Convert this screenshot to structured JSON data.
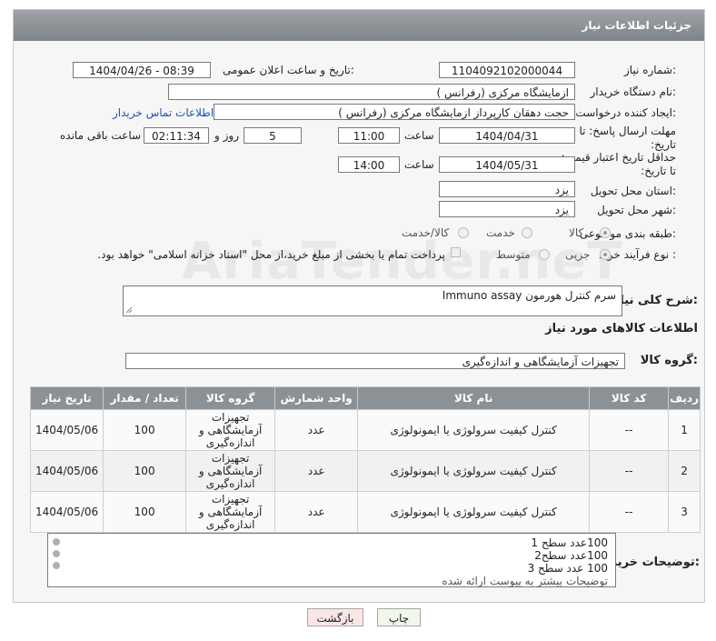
{
  "header": {
    "title": "جزئیات اطلاعات نیاز"
  },
  "watermark": "AriaTender.neT",
  "form": {
    "need_number_label": "شماره نیاز:",
    "need_number": "1104092102000044",
    "announce_label": "تاریخ و ساعت اعلان عمومی:",
    "announce_value": "1404/04/26 - 08:39",
    "buyer_org_label": "نام دستگاه خریدار:",
    "buyer_org": "ازمایشگاه مرکزی (رفرانس )",
    "creator_label": "ایجاد کننده درخواست:",
    "creator": "حجت دهقان کارپرداز ازمایشگاه مرکزی (رفرانس )",
    "contact_link": "اطلاعات تماس خریدار",
    "reply_deadline_label": "مهلت ارسال پاسخ: تا تاریخ:",
    "reply_date": "1404/04/31",
    "time_label": "ساعت",
    "reply_time": "11:00",
    "days_value": "5",
    "days_label": "روز و",
    "remaining_value": "02:11:34",
    "remaining_label": "ساعت باقی مانده",
    "price_deadline_label": "حداقل تاریخ اعتبار قیمت: تا تاریخ:",
    "price_date": "1404/05/31",
    "price_time_label": "ساعت",
    "price_time": "14:00",
    "province_label": "استان محل تحویل:",
    "province": "یزد",
    "city_label": "شهر محل تحویل:",
    "city": "یزد",
    "category_label": "طبقه بندی موضوعی:",
    "category_options": [
      "کالا",
      "خدمت",
      "کالا/خدمت"
    ],
    "process_label": "نوع فرآیند خرید :",
    "process_options": [
      "جزیی",
      "متوسط"
    ],
    "payment_note": "پرداخت تمام یا بخشی از مبلغ خرید،از محل \"اسناد خزانه اسلامی\" خواهد بود.",
    "desc_label": "شرح کلی نیاز:",
    "description": "سرم کنترل هورمون Immuno assay",
    "goods_section_title": "اطلاعات کالاهای مورد نیاز",
    "goods_group_label": "گروه کالا:",
    "goods_group": "تجهیزات آزمایشگاهی و اندازه‌گیری"
  },
  "table": {
    "headers": [
      "ردیف",
      "کد کالا",
      "نام کالا",
      "واحد شمارش",
      "گروه کالا",
      "تعداد / مقدار",
      "تاریخ نیاز"
    ],
    "rows": [
      [
        "1",
        "--",
        "کنترل کیفیت سرولوژی یا ایمونولوژی",
        "عدد",
        "تجهیزات آزمایشگاهی و اندازه‌گیری",
        "100",
        "1404/05/06"
      ],
      [
        "2",
        "--",
        "کنترل کیفیت سرولوژی یا ایمونولوژی",
        "عدد",
        "تجهیزات آزمایشگاهی و اندازه‌گیری",
        "100",
        "1404/05/06"
      ],
      [
        "3",
        "--",
        "کنترل کیفیت سرولوژی یا ایمونولوژی",
        "عدد",
        "تجهیزات آزمایشگاهی و اندازه‌گیری",
        "100",
        "1404/05/06"
      ]
    ]
  },
  "notes": {
    "label": "توضیحات خریدار:",
    "lines": [
      "100عدد سطح 1",
      "100عدد سطح2",
      "100 عدد سطح 3",
      "توضیحات بیشتر به پیوست ارائه شده"
    ]
  },
  "buttons": {
    "print": "چاپ",
    "back": "بازگشت"
  }
}
